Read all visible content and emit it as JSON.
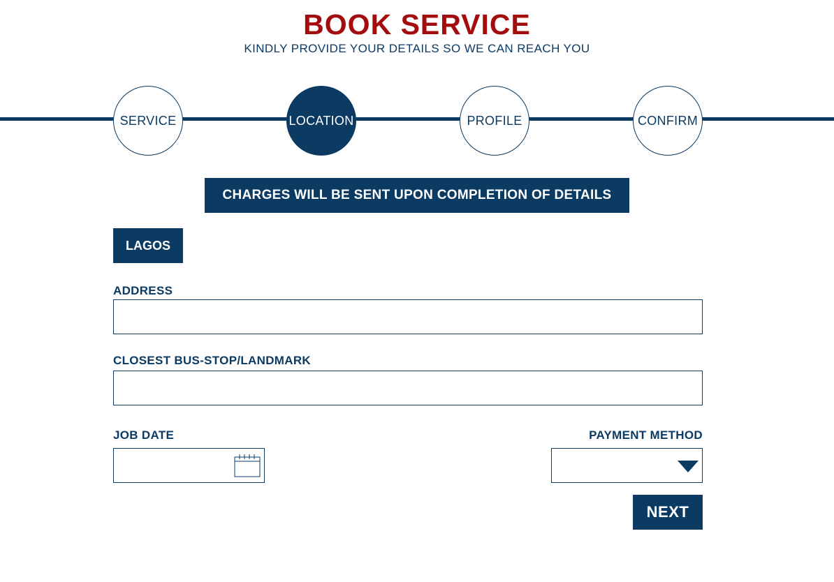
{
  "header": {
    "title": "BOOK SERVICE",
    "subtitle": "KINDLY PROVIDE YOUR DETAILS SO WE CAN REACH YOU"
  },
  "stepper": {
    "steps": [
      {
        "label": "SERVICE",
        "active": false
      },
      {
        "label": "LOCATION",
        "active": true
      },
      {
        "label": "PROFILE",
        "active": false
      },
      {
        "label": "CONFIRM",
        "active": false
      }
    ]
  },
  "banner": {
    "text": "CHARGES WILL BE SENT UPON COMPLETION OF DETAILS"
  },
  "location": {
    "city_label": "LAGOS"
  },
  "form": {
    "address": {
      "label": "ADDRESS",
      "value": "",
      "placeholder": ""
    },
    "landmark": {
      "label": "CLOSEST BUS-STOP/LANDMARK",
      "value": "",
      "placeholder": ""
    },
    "job_date": {
      "label": "JOB DATE",
      "value": "",
      "icon": "calendar-icon"
    },
    "payment_method": {
      "label": "PAYMENT METHOD",
      "selected": "",
      "icon": "chevron-down-icon"
    }
  },
  "actions": {
    "next_label": "NEXT"
  },
  "colors": {
    "primary": "#0b3a63",
    "title": "#a30d0d",
    "background": "#ffffff"
  }
}
